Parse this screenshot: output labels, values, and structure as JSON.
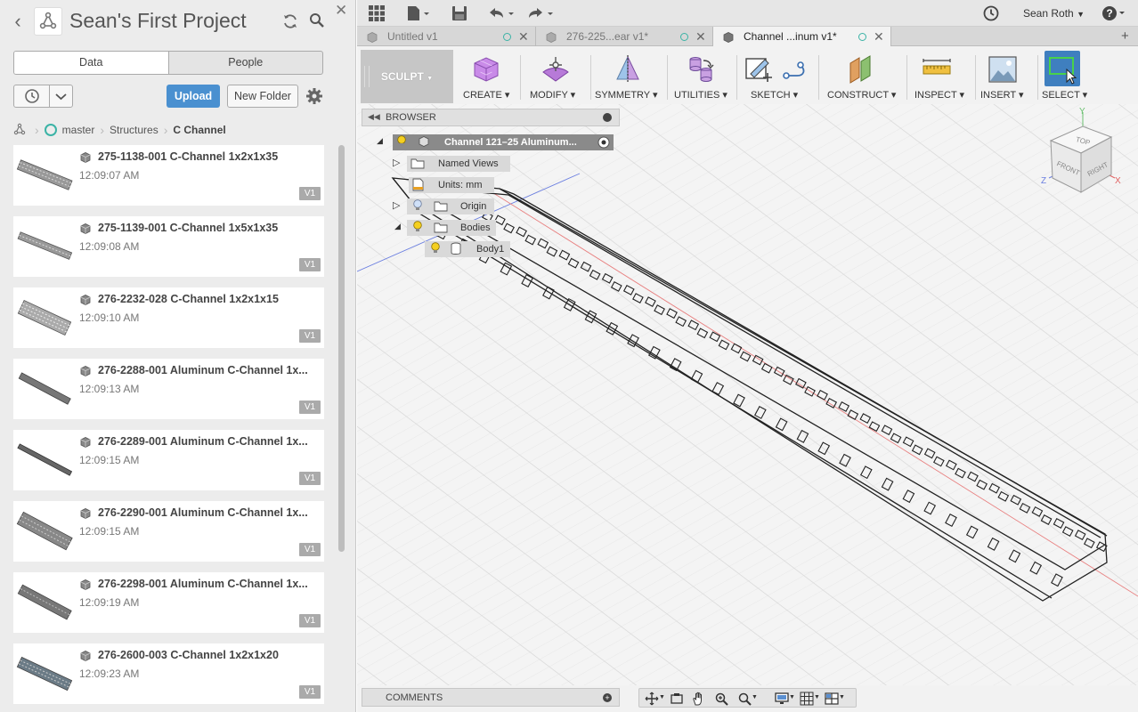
{
  "data_panel": {
    "title": "Sean's First Project",
    "tabs": [
      {
        "label": "Data",
        "active": true
      },
      {
        "label": "People",
        "active": false
      }
    ],
    "upload_label": "Upload",
    "new_folder_label": "New Folder",
    "breadcrumb": {
      "branch": "master",
      "folder1": "Structures",
      "folder2": "C Channel"
    },
    "files": [
      {
        "name": "275-1138-001 C-Channel 1x2x1x35",
        "time": "12:09:07 AM",
        "version": "V1"
      },
      {
        "name": "275-1139-001 C-Channel 1x5x1x35",
        "time": "12:09:08 AM",
        "version": "V1"
      },
      {
        "name": "276-2232-028 C-Channel 1x2x1x15",
        "time": "12:09:10 AM",
        "version": "V1"
      },
      {
        "name": "276-2288-001 Aluminum C-Channel 1x...",
        "time": "12:09:13 AM",
        "version": "V1"
      },
      {
        "name": "276-2289-001 Aluminum C-Channel 1x...",
        "time": "12:09:15 AM",
        "version": "V1"
      },
      {
        "name": "276-2290-001 Aluminum C-Channel 1x...",
        "time": "12:09:15 AM",
        "version": "V1"
      },
      {
        "name": "276-2298-001 Aluminum C-Channel 1x...",
        "time": "12:09:19 AM",
        "version": "V1"
      },
      {
        "name": "276-2600-003 C-Channel 1x2x1x20",
        "time": "12:09:23 AM",
        "version": "V1"
      }
    ]
  },
  "app_bar": {
    "user_name": "Sean Roth",
    "help": "?"
  },
  "doc_tabs": [
    {
      "label": "Untitled v1",
      "active": false
    },
    {
      "label": "276-225...ear v1*",
      "active": false
    },
    {
      "label": "Channel ...inum v1*",
      "active": true
    }
  ],
  "toolbar": {
    "workspace": "SCULPT",
    "groups": [
      {
        "label": "CREATE",
        "icon": "create-box-icon"
      },
      {
        "label": "MODIFY",
        "icon": "modify-icon"
      },
      {
        "label": "SYMMETRY",
        "icon": "symmetry-icon"
      },
      {
        "label": "UTILITIES",
        "icon": "utilities-icon"
      },
      {
        "label": "SKETCH",
        "icon": "sketch-icon"
      },
      {
        "label": "CONSTRUCT",
        "icon": "construct-plane-icon"
      },
      {
        "label": "INSPECT",
        "icon": "measure-ruler-icon"
      },
      {
        "label": "INSERT",
        "icon": "insert-image-icon"
      },
      {
        "label": "SELECT",
        "icon": "select-box-icon"
      }
    ]
  },
  "browser": {
    "title": "BROWSER",
    "root": "Channel 121–25 Aluminum...",
    "items": [
      "Named Views",
      "Units: mm",
      "Origin",
      "Bodies",
      "Body1"
    ]
  },
  "comments": {
    "title": "COMMENTS"
  },
  "viewcube": {
    "top": "TOP",
    "front": "FRONT",
    "right": "RIGHT",
    "axis_x": "X",
    "axis_y": "Y",
    "axis_z": "Z"
  },
  "colors": {
    "accent": "#4a90d0",
    "branch": "#3bb3a6",
    "select_active": "#3f7fbf"
  }
}
